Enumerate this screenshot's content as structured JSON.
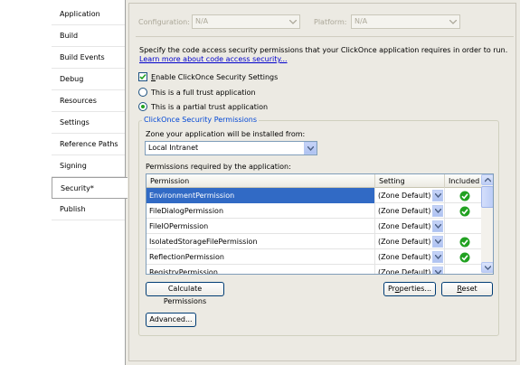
{
  "tabs": [
    {
      "label": "Application"
    },
    {
      "label": "Build"
    },
    {
      "label": "Build Events"
    },
    {
      "label": "Debug"
    },
    {
      "label": "Resources"
    },
    {
      "label": "Settings"
    },
    {
      "label": "Reference Paths"
    },
    {
      "label": "Signing"
    },
    {
      "label": "Security*",
      "selected": true
    },
    {
      "label": "Publish"
    }
  ],
  "config_bar": {
    "configuration_label": "Configuration:",
    "configuration_value": "N/A",
    "platform_label": "Platform:",
    "platform_value": "N/A"
  },
  "description": {
    "text": "Specify the code access security permissions that your ClickOnce application requires in order to run.",
    "link": "Learn more about code access security..."
  },
  "enable_checkbox": {
    "label_prefix": "E",
    "label_rest": "nable ClickOnce Security Settings",
    "checked": true
  },
  "trust": {
    "full_label": "This is a full trust application",
    "partial_label": "This is a partial trust application",
    "selected": "partial"
  },
  "group": {
    "title": "ClickOnce Security Permissions",
    "zone_label": "Zone your application will be installed from:",
    "zone_value": "Local Intranet",
    "permissions_label": "Permissions required by the application:"
  },
  "grid": {
    "headers": {
      "permission": "Permission",
      "setting": "Setting",
      "included": "Included"
    },
    "rows": [
      {
        "permission": "EnvironmentPermission",
        "setting": "(Zone Default)",
        "included": true,
        "selected": true
      },
      {
        "permission": "FileDialogPermission",
        "setting": "(Zone Default)",
        "included": true
      },
      {
        "permission": "FileIOPermission",
        "setting": "(Zone Default)",
        "included": false
      },
      {
        "permission": "IsolatedStorageFilePermission",
        "setting": "(Zone Default)",
        "included": true
      },
      {
        "permission": "ReflectionPermission",
        "setting": "(Zone Default)",
        "included": true
      },
      {
        "permission": "RegistryPermission",
        "setting": "(Zone Default)",
        "included": false
      }
    ]
  },
  "buttons": {
    "calculate": "Calculate Permissions",
    "properties_pre": "Pr",
    "properties_u": "o",
    "properties_post": "perties...",
    "reset_u": "R",
    "reset_post": "eset",
    "advanced": "Advanced..."
  },
  "colors": {
    "accent": "#316ac5",
    "group_title": "#0046d5",
    "panel_bg": "#eceae3",
    "check_green": "#21a121"
  }
}
